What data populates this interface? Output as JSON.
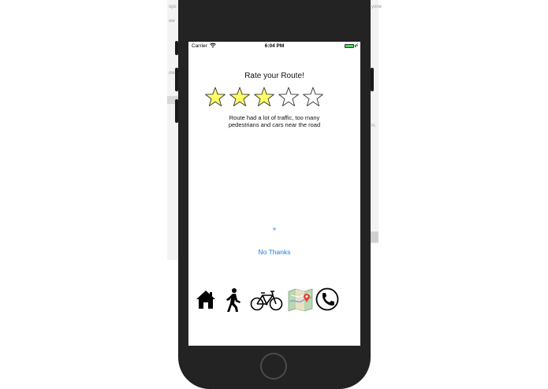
{
  "background": {
    "left_fragments": [
      "ops",
      "ew",
      "ow"
    ],
    "right_fragments": [
      "yone",
      "in"
    ]
  },
  "status_bar": {
    "carrier": "Carrier",
    "time": "6:04 PM",
    "battery_level": 1.0
  },
  "rating": {
    "title": "Rate your Route!",
    "value": 3,
    "max": 5,
    "filled_color": "#ffff66",
    "comment_line1": "Route had a lot of traffic, too many",
    "comment_line2": "pedestrians and cars near the road"
  },
  "actions": {
    "plus_label": "+",
    "no_thanks_label": "No Thanks"
  },
  "tab_icons": [
    "home-icon",
    "walking-icon",
    "bicycle-icon",
    "map-icon",
    "phone-icon"
  ],
  "colors": {
    "accent": "#1a7cd6",
    "frame": "#232323"
  }
}
